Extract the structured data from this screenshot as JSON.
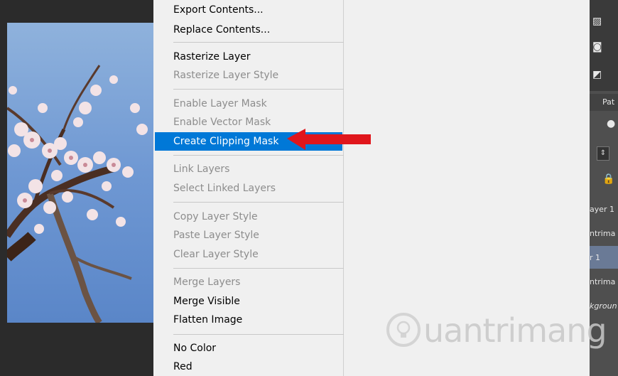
{
  "menu": {
    "items": [
      {
        "label": "Export Contents...",
        "state": "normal"
      },
      {
        "label": "Replace Contents...",
        "state": "normal"
      },
      {
        "label": "Rasterize Layer",
        "state": "normal"
      },
      {
        "label": "Rasterize Layer Style",
        "state": "disabled"
      },
      {
        "label": "Enable Layer Mask",
        "state": "disabled"
      },
      {
        "label": "Enable Vector Mask",
        "state": "disabled"
      },
      {
        "label": "Create Clipping Mask",
        "state": "highlighted"
      },
      {
        "label": "Link Layers",
        "state": "disabled"
      },
      {
        "label": "Select Linked Layers",
        "state": "disabled"
      },
      {
        "label": "Copy Layer Style",
        "state": "disabled"
      },
      {
        "label": "Paste Layer Style",
        "state": "disabled"
      },
      {
        "label": "Clear Layer Style",
        "state": "disabled"
      },
      {
        "label": "Merge Layers",
        "state": "disabled"
      },
      {
        "label": "Merge Visible",
        "state": "normal"
      },
      {
        "label": "Flatten Image",
        "state": "normal"
      },
      {
        "label": "No Color",
        "state": "normal"
      },
      {
        "label": "Red",
        "state": "normal"
      }
    ]
  },
  "layers_panel": {
    "tab_fragment": "Pat",
    "rows": [
      "ayer 1",
      "ntrima",
      "r 1",
      "ntrima",
      "kgroun"
    ],
    "icons": [
      "adjustments-icon",
      "camera-icon",
      "levels-icon",
      "brush-icon",
      "stepper-icon",
      "lock-icon"
    ]
  },
  "colors": {
    "highlight": "#0078d7",
    "disabled_text": "#8d8d8d",
    "menu_bg": "#f0f0f0",
    "arrow": "#e0161c",
    "panel_bg": "#4f4f4f",
    "selected_layer": "#6a7a96"
  },
  "watermark": {
    "text": "uantrimang"
  }
}
